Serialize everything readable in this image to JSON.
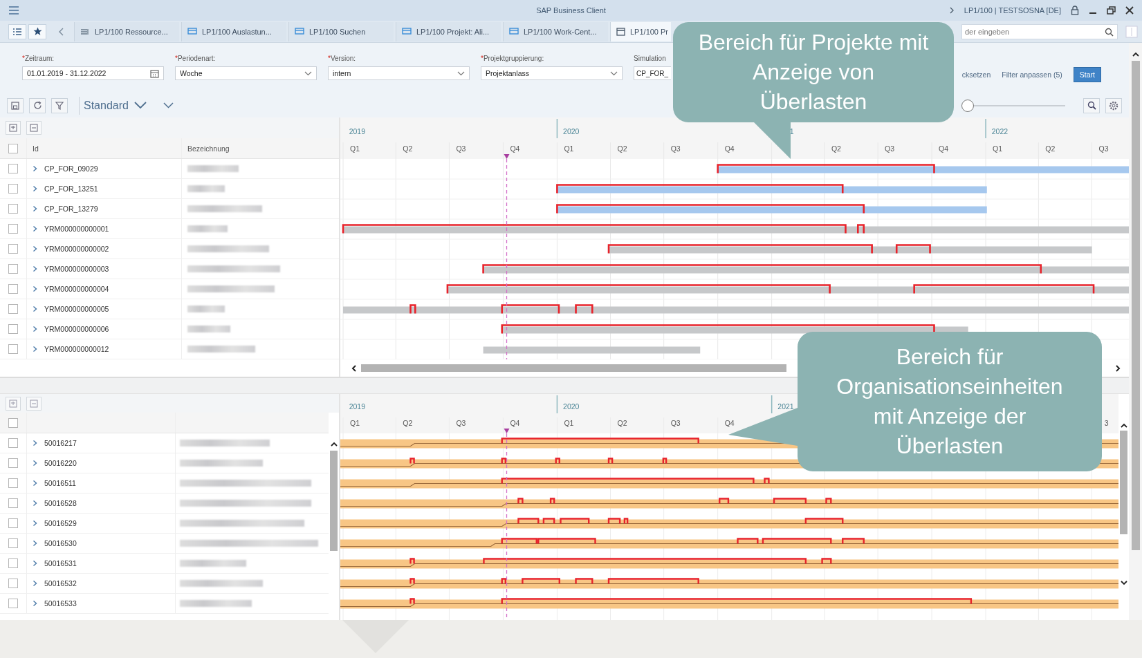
{
  "title_bar": {
    "title": "SAP Business Client",
    "session": "LP1/100 | TESTSOSNA [DE]"
  },
  "tabs": [
    {
      "kind": "resource",
      "label": "LP1/100 Ressource...",
      "selected": false
    },
    {
      "kind": "view",
      "label": "LP1/100 Auslastun...",
      "selected": false
    },
    {
      "kind": "view",
      "label": "LP1/100 Suchen",
      "selected": false
    },
    {
      "kind": "view",
      "label": "LP1/100 Projekt: Ali...",
      "selected": false
    },
    {
      "kind": "view",
      "label": "LP1/100 Work-Cent...",
      "selected": false
    },
    {
      "kind": "calendar",
      "label": "LP1/100 Pr",
      "selected": true
    }
  ],
  "search": {
    "placeholder": "der eingeben"
  },
  "filters": [
    {
      "mark": "*",
      "label": "Zeitraum:",
      "value": "01.01.2019 - 31.12.2022",
      "kind": "date"
    },
    {
      "mark": "*",
      "label": "Periodenart:",
      "value": "Woche",
      "kind": "dropdown"
    },
    {
      "mark": "*",
      "label": "Version:",
      "value": "intern",
      "kind": "dropdown"
    },
    {
      "mark": "*",
      "label": "Projektgruppierung:",
      "value": "Projektanlass",
      "kind": "dropdown"
    },
    {
      "label": "Simulation",
      "value": "CP_FOR_",
      "kind": "text"
    }
  ],
  "filter_actions": [
    {
      "label": "cksetzen",
      "kind": "link"
    },
    {
      "label": "Filter anpassen (5)",
      "kind": "link"
    },
    {
      "label": "Start",
      "kind": "primary"
    }
  ],
  "toolbar": {
    "variant": "Standard",
    "zoom": {
      "level": 0
    }
  },
  "projects": {
    "select_all": {
      "checked": false
    },
    "columns": [
      "Id",
      "Bezeichnung"
    ],
    "axis": {
      "years": [
        "2019",
        "2020",
        "1",
        "2022"
      ],
      "quarters": [
        "Q1",
        "Q2",
        "Q3",
        "Q4",
        "Q1",
        "Q2",
        "Q3",
        "Q4",
        "Q2",
        "Q3",
        "Q4",
        "Q1",
        "Q2",
        "Q3"
      ]
    },
    "rows": [
      {
        "id": "CP_FOR_09029",
        "checked": false,
        "expanded": false,
        "color": "#a6c8ee"
      },
      {
        "id": "CP_FOR_13251",
        "checked": false,
        "expanded": false,
        "color": "#a6c8ee"
      },
      {
        "id": "CP_FOR_13279",
        "checked": false,
        "expanded": false,
        "color": "#a6c8ee"
      },
      {
        "id": "YRM000000000001",
        "checked": false,
        "expanded": false,
        "color": "#c6c8ca"
      },
      {
        "id": "YRM000000000002",
        "checked": false,
        "expanded": false,
        "color": "#c6c8ca"
      },
      {
        "id": "YRM000000000003",
        "checked": false,
        "expanded": false,
        "color": "#c6c8ca"
      },
      {
        "id": "YRM000000000004",
        "checked": false,
        "expanded": false,
        "color": "#c6c8ca"
      },
      {
        "id": "YRM000000000005",
        "checked": false,
        "expanded": false,
        "color": "#c6c8ca"
      },
      {
        "id": "YRM000000000006",
        "checked": false,
        "expanded": false,
        "color": "#c6c8ca"
      },
      {
        "id": "YRM000000000012",
        "checked": false,
        "expanded": false,
        "color": "#c6c8ca"
      }
    ]
  },
  "org_units": {
    "select_all": {
      "checked": false
    },
    "axis": {
      "years": [
        "2019",
        "2020",
        "2021"
      ],
      "quarters": [
        "Q1",
        "Q2",
        "Q3",
        "Q4",
        "Q1",
        "Q2",
        "Q3",
        "Q4",
        "3"
      ]
    },
    "rows": [
      {
        "id": "50016217",
        "checked": false,
        "expanded": false
      },
      {
        "id": "50016220",
        "checked": false,
        "expanded": false
      },
      {
        "id": "50016511",
        "checked": false,
        "expanded": false
      },
      {
        "id": "50016528",
        "checked": false,
        "expanded": false
      },
      {
        "id": "50016529",
        "checked": false,
        "expanded": false
      },
      {
        "id": "50016530",
        "checked": false,
        "expanded": false
      },
      {
        "id": "50016531",
        "checked": false,
        "expanded": false
      },
      {
        "id": "50016532",
        "checked": false,
        "expanded": false
      },
      {
        "id": "50016533",
        "checked": false,
        "expanded": false
      }
    ]
  },
  "callouts": [
    {
      "text": "Bereich für Projekte mit Anzeige von Überlasten"
    },
    {
      "text": "Bereich für Organisationseinheiten mit Anzeige der Überlasten"
    }
  ]
}
